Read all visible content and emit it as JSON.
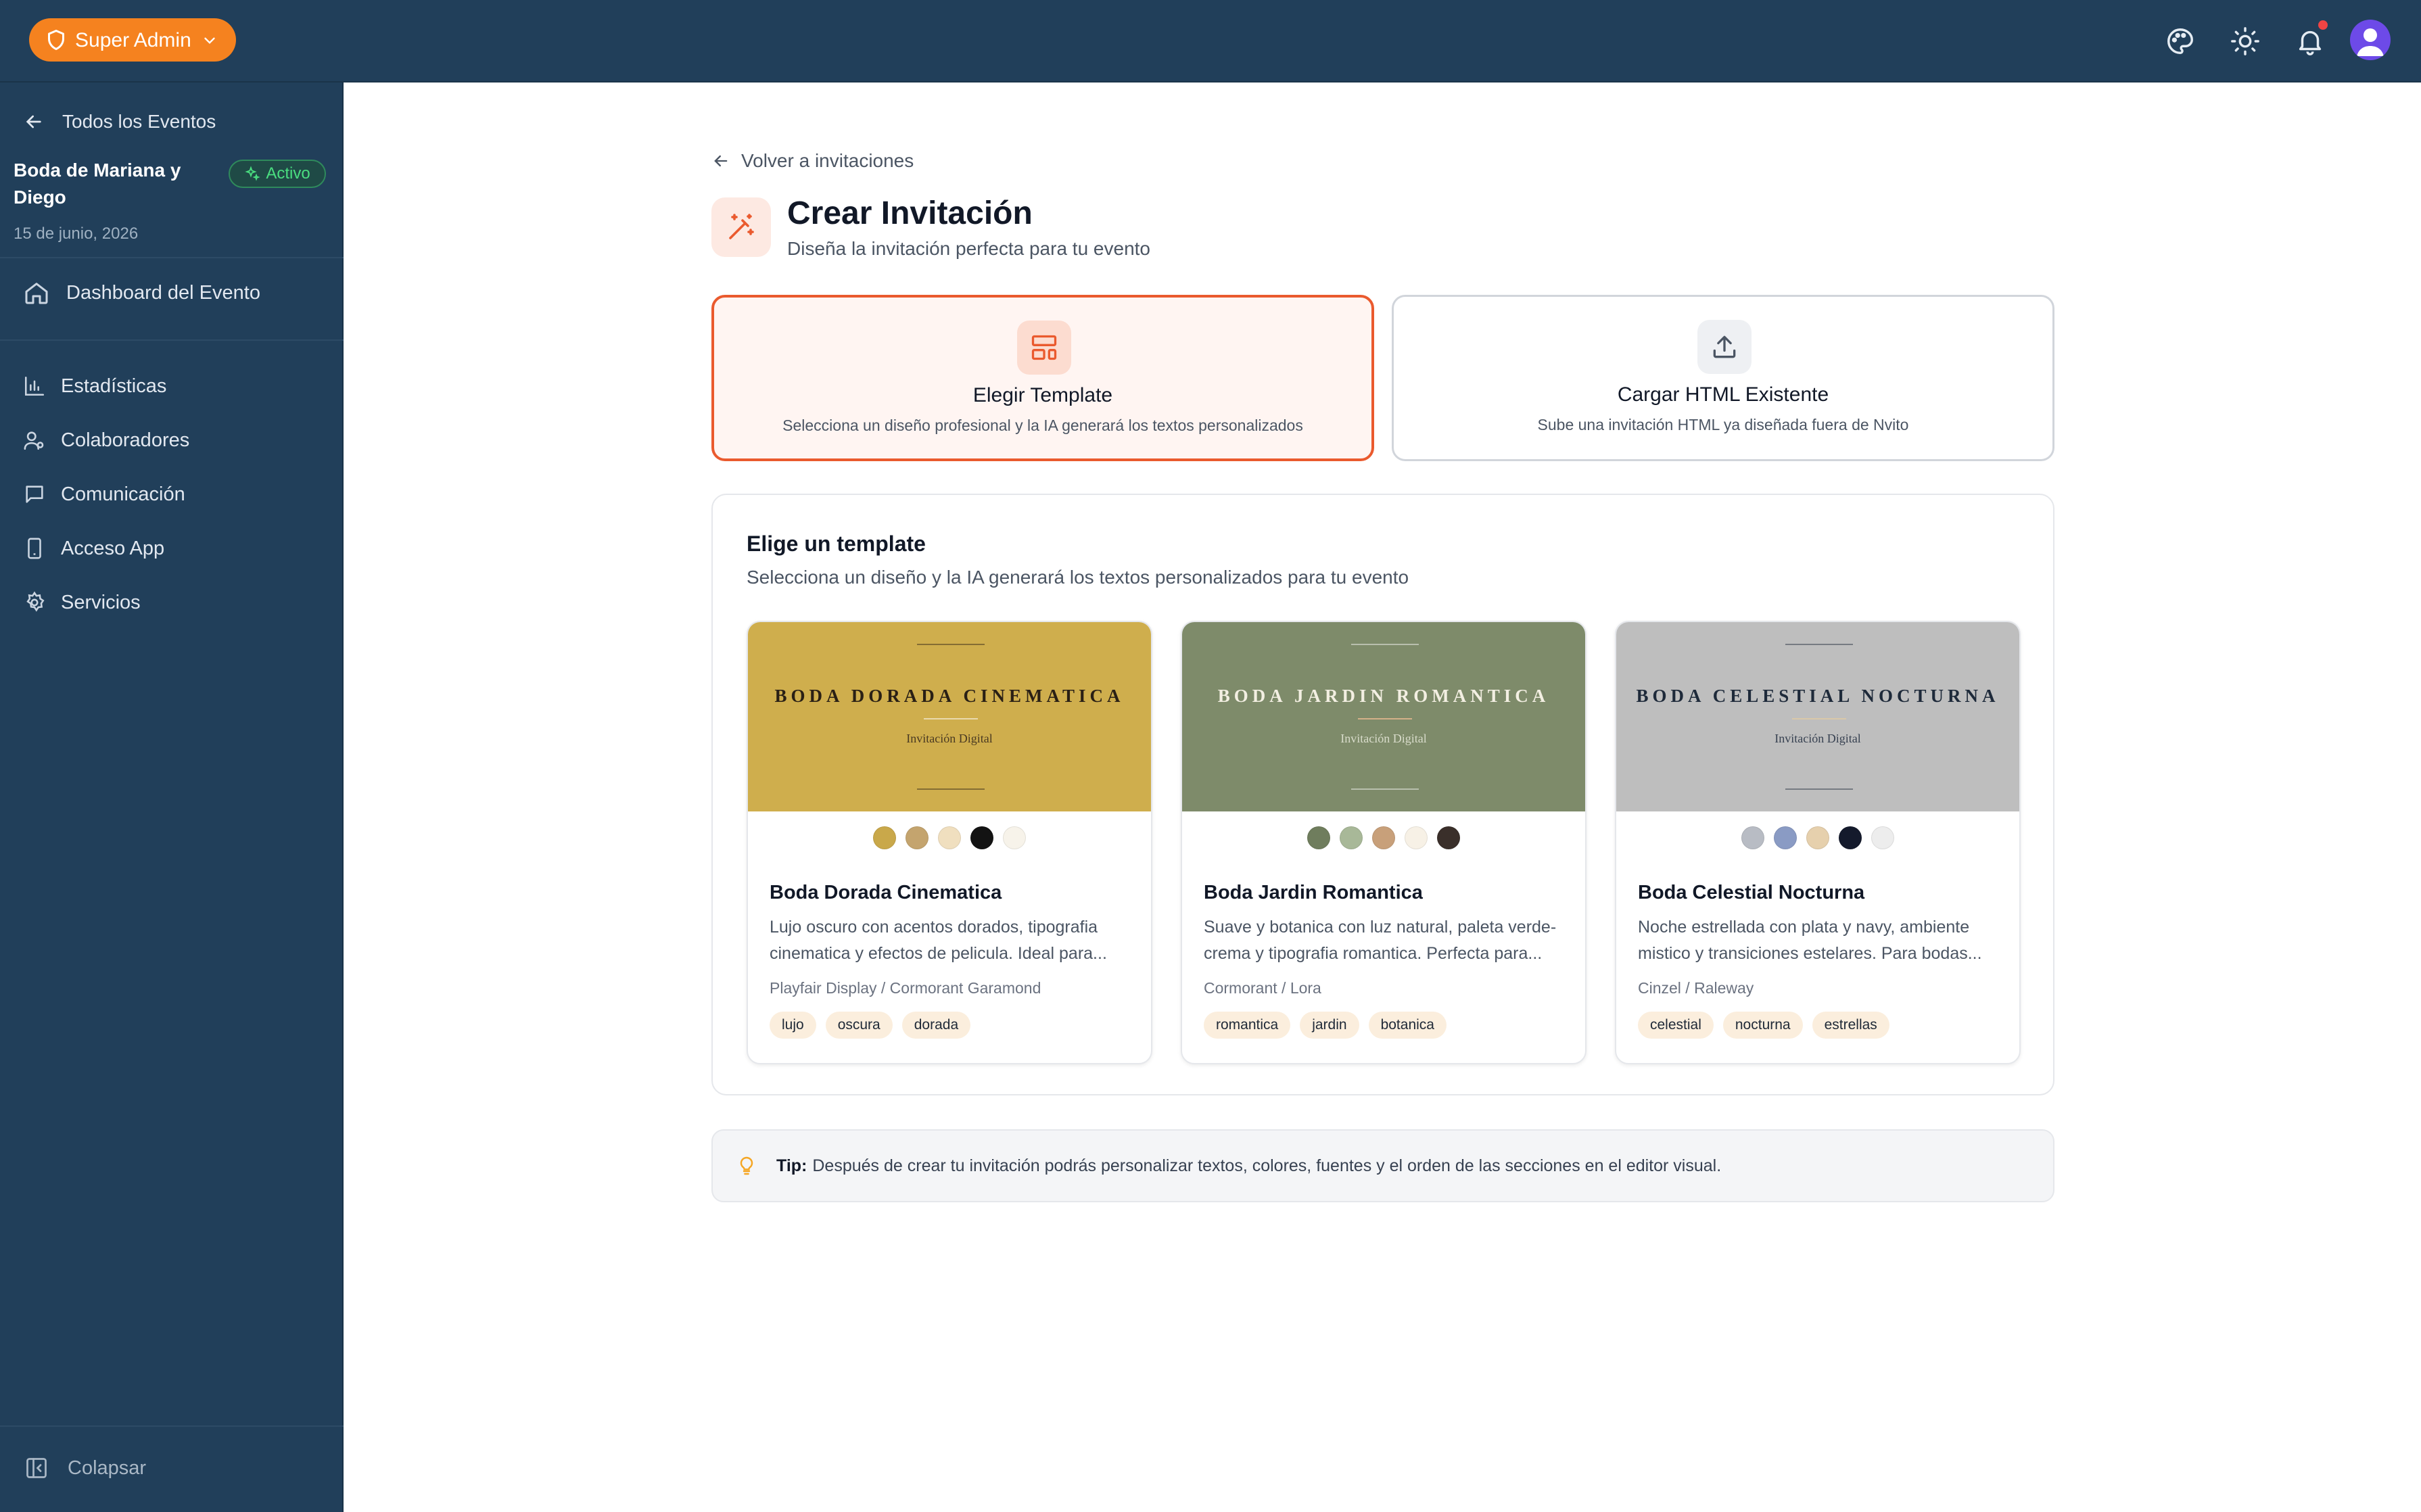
{
  "topbar": {
    "role_label": "Super Admin",
    "icons": [
      "palette-icon",
      "sun-icon",
      "bell-icon",
      "user-avatar"
    ],
    "accent": "#f5821f",
    "background": "#213f5a"
  },
  "sidebar": {
    "back_label": "Todos los Eventos",
    "event_name": "Boda de Mariana y Diego",
    "status": "Activo",
    "event_date": "15 de junio, 2026",
    "dashboard_label": "Dashboard del Evento",
    "items": [
      {
        "label": "Estadísticas",
        "icon": "bar-chart-icon"
      },
      {
        "label": "Colaboradores",
        "icon": "users-icon"
      },
      {
        "label": "Comunicación",
        "icon": "message-icon"
      },
      {
        "label": "Acceso App",
        "icon": "smartphone-icon"
      },
      {
        "label": "Servicios",
        "icon": "gear-icon"
      }
    ],
    "collapse_label": "Colapsar"
  },
  "main": {
    "back_link": "Volver a invitaciones",
    "title": "Crear Invitación",
    "subtitle": "Diseña la invitación perfecta para tu evento",
    "modes": [
      {
        "title": "Elegir Template",
        "desc": "Selecciona un diseño profesional y la IA generará los textos personalizados",
        "selected": true
      },
      {
        "title": "Cargar HTML Existente",
        "desc": "Sube una invitación HTML ya diseñada fuera de Nvito",
        "selected": false
      }
    ],
    "templates_heading": "Elige un template",
    "templates_subheading": "Selecciona un diseño y la IA generará los textos personalizados para tu evento",
    "templates": [
      {
        "art_title": "BODA DORADA CINEMATICA",
        "art_subtitle": "Invitación Digital",
        "bg": "#cfae4d",
        "art_color": "#2a2015",
        "name": "Boda Dorada Cinematica",
        "description": "Lujo oscuro con acentos dorados, tipografia cinematica y efectos de pelicula. Ideal para...",
        "fonts": "Playfair Display / Cormorant Garamond",
        "swatches": [
          "#c9a84a",
          "#c4a46e",
          "#f0dfbf",
          "#131313",
          "#f7f3ea"
        ],
        "tags": [
          "lujo",
          "oscura",
          "dorada"
        ]
      },
      {
        "art_title": "BODA JARDIN ROMANTICA",
        "art_subtitle": "Invitación Digital",
        "bg": "#7e8b6a",
        "art_color": "#f3efe2",
        "name": "Boda Jardin Romantica",
        "description": "Suave y botanica con luz natural, paleta verde-crema y tipografia romantica. Perfecta para...",
        "fonts": "Cormorant / Lora",
        "swatches": [
          "#6f7d5d",
          "#a8b898",
          "#c8a07a",
          "#f7f1e6",
          "#3a2f2a"
        ],
        "tags": [
          "romantica",
          "jardin",
          "botanica"
        ]
      },
      {
        "art_title": "BODA CELESTIAL NOCTURNA",
        "art_subtitle": "Invitación Digital",
        "bg": "#bebebe",
        "art_color": "#1e2a3a",
        "name": "Boda Celestial Nocturna",
        "description": "Noche estrellada con plata y navy, ambiente mistico y transiciones estelares. Para bodas...",
        "fonts": "Cinzel / Raleway",
        "swatches": [
          "#b8bcc4",
          "#8a9bc4",
          "#e6d0ad",
          "#141a2c",
          "#ededed"
        ],
        "tags": [
          "celestial",
          "nocturna",
          "estrellas"
        ]
      }
    ],
    "tip_label": "Tip:",
    "tip_text": "Después de crear tu invitación podrás personalizar textos, colores, fuentes y el orden de las secciones en el editor visual."
  }
}
